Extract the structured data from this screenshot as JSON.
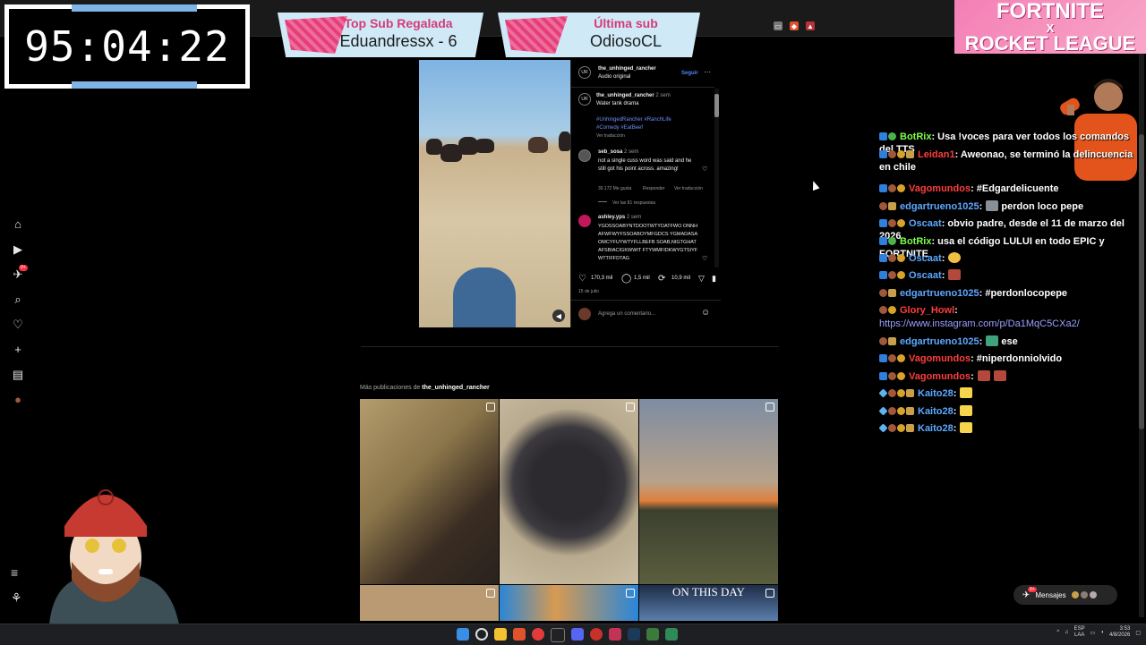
{
  "timer": {
    "value": "95:04:22"
  },
  "banners": {
    "top_sub": {
      "title": "Top Sub Regalada",
      "value": "Eduandressx - 6"
    },
    "last_sub": {
      "title": "Última sub",
      "value": "OdiosoCL"
    },
    "fortnite": {
      "line1": "FORTNITE",
      "line2": "X",
      "line3": "ROCKET LEAGUE"
    }
  },
  "left_nav": {
    "items": [
      {
        "name": "home-icon",
        "glyph": "⌂"
      },
      {
        "name": "reels-icon",
        "glyph": "▶"
      },
      {
        "name": "messages-nav-icon",
        "glyph": "✈"
      },
      {
        "name": "search-icon",
        "glyph": "⌕"
      },
      {
        "name": "heart-icon",
        "glyph": "♡"
      },
      {
        "name": "create-icon",
        "glyph": "+"
      },
      {
        "name": "dashboard-icon",
        "glyph": "▤"
      },
      {
        "name": "profile-icon",
        "glyph": "●"
      }
    ],
    "messages_badge": "9+",
    "menu_glyph": "≡",
    "meta_glyph": "⚘"
  },
  "post": {
    "username": "the_unhinged_rancher",
    "audio": "Audio original",
    "follow": "Seguir",
    "more": "···",
    "avatar_initials": "UR",
    "caption_user": "the_unhinged_rancher",
    "caption_time": "2 sem",
    "caption_text": "Water tank drama",
    "hashtags_l1": "#UnhingedRancher #RanchLife",
    "hashtags_l2": "#Comedy #EatBeef",
    "translate": "Ver traducción",
    "comment1": {
      "user": "seb_sosa",
      "time": "2 sem",
      "text": "not a single cuss word was said and he still got his point across. amazing!",
      "likes": "39.172 Me gusta",
      "reply": "Responder",
      "translate": "Ver traducción",
      "replies": "Ver las 81 respuestas"
    },
    "comment2": {
      "user": "ashley.yps",
      "time": "2 sem",
      "text": "YGDSSOABYNTDOOTWTYDATFWO ONNHAFWFWYFSSOABOYMFGDCS YGMADASAOMCYFUYWTYFLLBEFB SOAB,NIGTGHATAFSBIACIGKWWIT FTYWMFIDKWYGTSIYFWTTIFFDTAG"
    },
    "likes": "170,3 mil",
    "comments": "1,5 mil",
    "shares": "10,9 mil",
    "date": "15 de julio",
    "comment_placeholder": "Agrega un comentario..."
  },
  "more_posts": {
    "label": "Más publicaciones de",
    "user": "the_unhinged_rancher",
    "grid_overlay_text": "ON THIS DAY"
  },
  "chat": {
    "messages": [
      {
        "user": "BotRix",
        "color": "#7cff4a",
        "badges": [
          "b-blue",
          "b-green"
        ],
        "text": ": Usa !voces para ver todos los comandos del TTS"
      },
      {
        "user": "Leidan1",
        "color": "#ff3d3d",
        "badges": [
          "b-blue",
          "b-pfp",
          "b-gold",
          "b-crown"
        ],
        "text": ": Aweonao, se terminó la delincuencia en chile"
      },
      {
        "user": "Vagomundos",
        "color": "#ff3d3d",
        "badges": [
          "b-blue",
          "b-pfp",
          "b-gold"
        ],
        "text": ": #Edgardelicuente"
      },
      {
        "user": "edgartrueno1025",
        "color": "#5ca8ff",
        "badges": [
          "b-pfp",
          "b-crown"
        ],
        "text": ":",
        "emote": "e-pic",
        "after": " perdon loco pepe"
      },
      {
        "user": "Oscaat",
        "color": "#5ca8ff",
        "badges": [
          "b-blue",
          "b-pfp",
          "b-gold"
        ],
        "text": ": obvio padre, desde el 11 de marzo del 2026"
      },
      {
        "user": "BotRix",
        "color": "#7cff4a",
        "badges": [
          "b-blue",
          "b-green"
        ],
        "text": ": usa el código LULUI en todo EPIC y FORTNITE"
      },
      {
        "user": "Oscaat",
        "color": "#5ca8ff",
        "badges": [
          "b-blue",
          "b-pfp",
          "b-gold"
        ],
        "text": ":",
        "emote": "e-yel",
        "after": ""
      },
      {
        "user": "Oscaat",
        "color": "#5ca8ff",
        "badges": [
          "b-blue",
          "b-pfp",
          "b-gold"
        ],
        "text": ":",
        "emote": "e-red",
        "after": ""
      },
      {
        "user": "edgartrueno1025",
        "color": "#5ca8ff",
        "badges": [
          "b-pfp",
          "b-crown"
        ],
        "text": ": #perdonlocopepe"
      },
      {
        "user": "Glory_Howl",
        "color": "#ff3d3d",
        "badges": [
          "b-pfp",
          "b-gold"
        ],
        "text": ":"
      },
      {
        "user": "",
        "color": "#9aa0ff",
        "badges": [],
        "text": "https://www.instagram.com/p/Da1MqC5CXa2/",
        "is_link": true
      },
      {
        "user": "edgartrueno1025",
        "color": "#5ca8ff",
        "badges": [
          "b-pfp",
          "b-crown"
        ],
        "text": ":",
        "emote": "e-grn",
        "after": " ese"
      },
      {
        "user": "Vagomundos",
        "color": "#ff3d3d",
        "badges": [
          "b-blue",
          "b-pfp",
          "b-gold"
        ],
        "text": ": #niperdonniolvido"
      },
      {
        "user": "Vagomundos",
        "color": "#ff3d3d",
        "badges": [
          "b-blue",
          "b-pfp",
          "b-gold"
        ],
        "text": ":",
        "emote": "e-red",
        "after": "",
        "emote2": "e-red"
      },
      {
        "user": "Kaito28",
        "color": "#5ca8ff",
        "badges": [
          "b-diamond",
          "b-pfp",
          "b-gold",
          "b-crown"
        ],
        "text": ":",
        "emote": "e-kai",
        "after": ""
      },
      {
        "user": "Kaito28",
        "color": "#5ca8ff",
        "badges": [
          "b-diamond",
          "b-pfp",
          "b-gold",
          "b-crown"
        ],
        "text": ":",
        "emote": "e-kai",
        "after": ""
      },
      {
        "user": "Kaito28",
        "color": "#5ca8ff",
        "badges": [
          "b-diamond",
          "b-pfp",
          "b-gold",
          "b-crown"
        ],
        "text": ":",
        "emote": "e-kai",
        "after": ""
      }
    ]
  },
  "messages_pill": {
    "label": "Mensajes",
    "badge": "9+"
  },
  "taskbar": {
    "lang": "ESP",
    "region": "LAA",
    "time": "3:53",
    "date": "4/8/2026"
  },
  "colors": {
    "accent_blue": "#4e86f7",
    "chat_red": "#ff3d3d",
    "chat_blue": "#5ca8ff",
    "chat_green": "#7cff4a"
  }
}
